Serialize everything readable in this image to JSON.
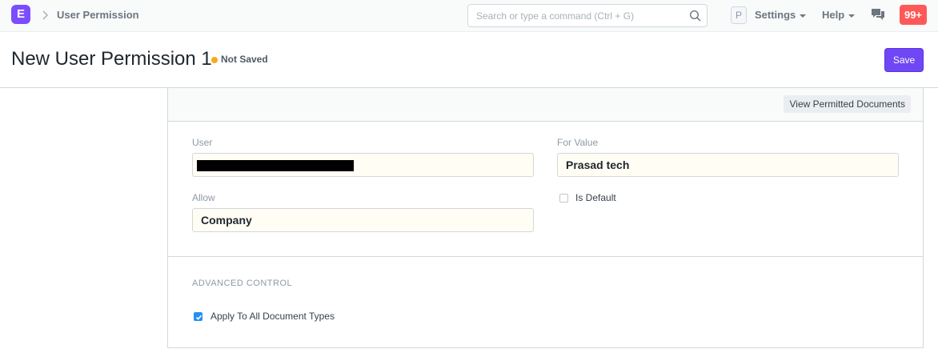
{
  "navbar": {
    "logo_letter": "E",
    "breadcrumb": "User Permission",
    "search_placeholder": "Search or type a command (Ctrl + G)",
    "avatar_letter": "P",
    "settings_label": "Settings",
    "help_label": "Help",
    "notification_count": "99+"
  },
  "page": {
    "title": "New User Permission 1",
    "status": "Not Saved",
    "save_label": "Save"
  },
  "form": {
    "view_permitted_label": "View Permitted Documents",
    "user_label": "User",
    "user_value": "",
    "for_value_label": "For Value",
    "for_value": "Prasad tech",
    "allow_label": "Allow",
    "allow_value": "Company",
    "is_default_label": "Is Default",
    "is_default_checked": false,
    "advanced_section_title": "ADVANCED CONTROL",
    "apply_all_label": "Apply To All Document Types",
    "apply_all_checked": true
  },
  "colors": {
    "brand": "#7c4dff",
    "primary_button": "#6f47f5",
    "notification": "#ff5858",
    "status_dot": "#f8a91d",
    "checkbox_checked": "#2490ef"
  },
  "icons": [
    "logo-icon",
    "chevron-right-icon",
    "search-icon",
    "chat-icon",
    "caret-down-icon",
    "check-icon"
  ]
}
